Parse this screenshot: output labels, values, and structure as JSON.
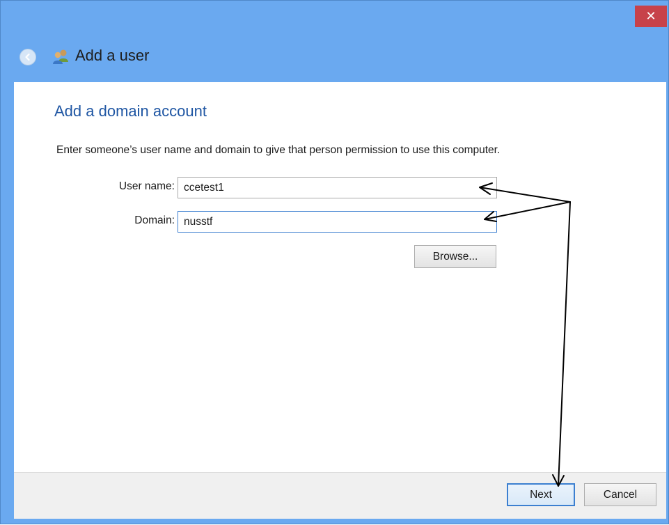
{
  "window": {
    "close_glyph": "✕",
    "nav_title": "Add a user"
  },
  "page": {
    "heading": "Add a domain account",
    "instruction": "Enter someone’s user name and domain to give that person permission to use this computer."
  },
  "form": {
    "username_label": "User name:",
    "username_value": "ccetest1",
    "domain_label": "Domain:",
    "domain_value": "nusstf",
    "browse_label": "Browse..."
  },
  "footer": {
    "next_label": "Next",
    "cancel_label": "Cancel"
  },
  "colors": {
    "titlebar": "#6aa9f0",
    "heading": "#1f56a3",
    "close_button": "#c7424a",
    "focus_border": "#3c7fd0"
  },
  "icons": [
    "back-arrow-icon",
    "users-icon",
    "close-icon"
  ]
}
